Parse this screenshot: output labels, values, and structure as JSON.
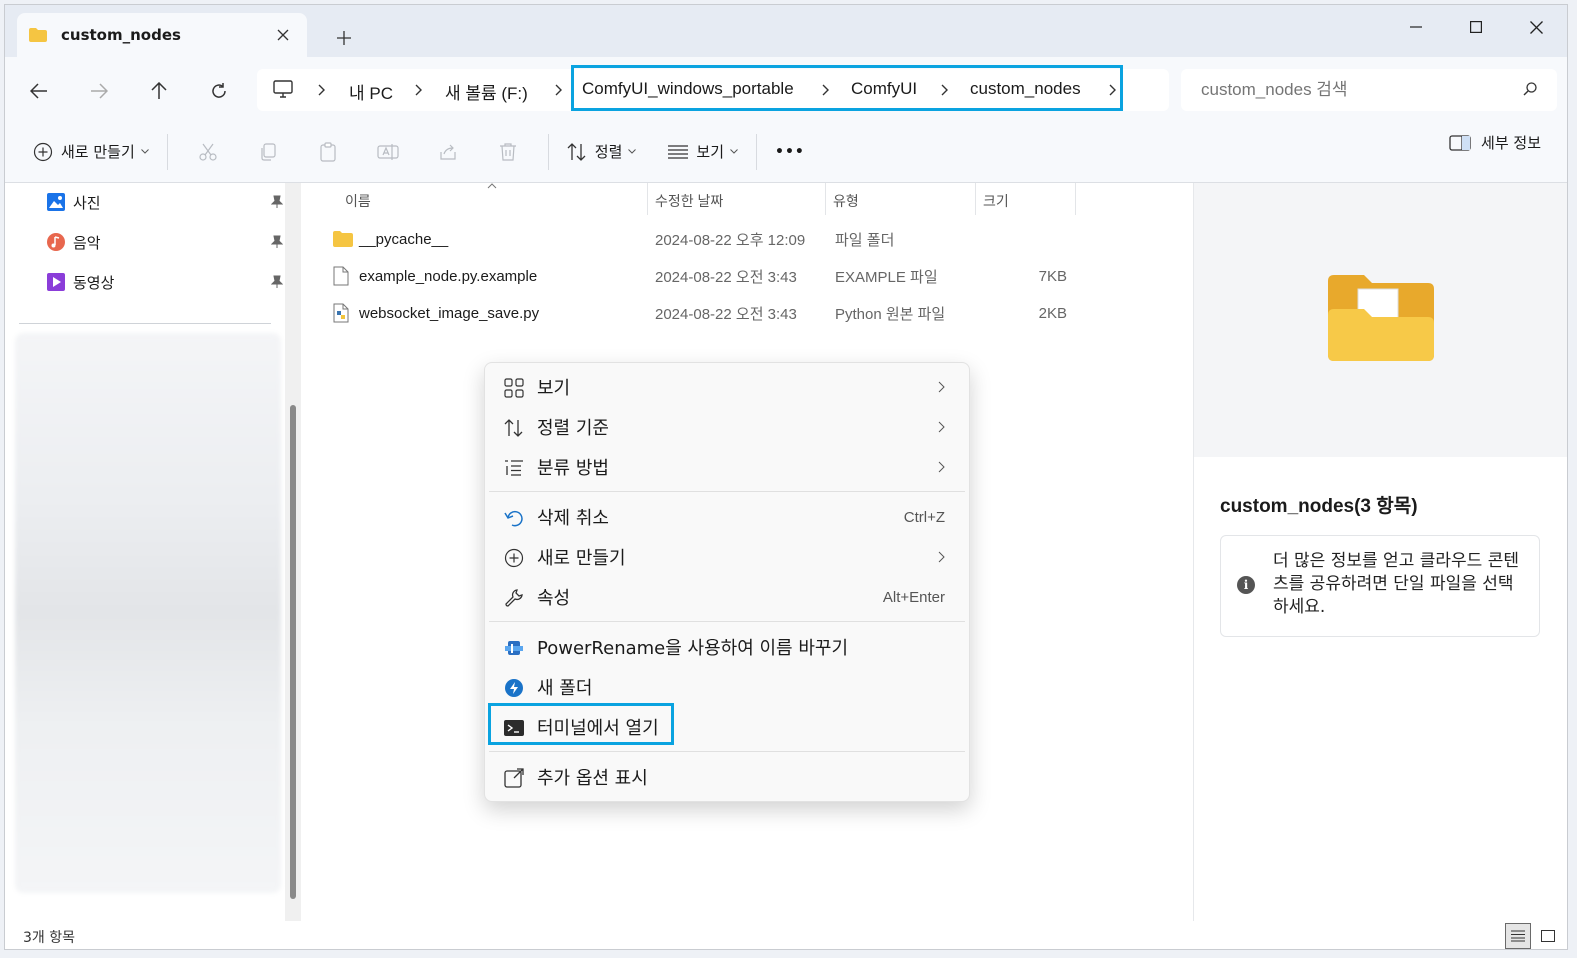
{
  "tab": {
    "title": "custom_nodes"
  },
  "address": {
    "crumbs": [
      "내 PC",
      "새 볼륨 (F:)",
      "ComfyUI_windows_portable",
      "ComfyUI",
      "custom_nodes"
    ]
  },
  "search": {
    "placeholder": "custom_nodes 검색"
  },
  "toolbar": {
    "new_label": "새로 만들기",
    "sort_label": "정렬",
    "view_label": "보기",
    "more_label": "•••",
    "details_label": "세부 정보"
  },
  "sidebar": {
    "items": [
      {
        "label": "사진"
      },
      {
        "label": "음악"
      },
      {
        "label": "동영상"
      }
    ]
  },
  "filelist": {
    "headers": [
      "이름",
      "수정한 날짜",
      "유형",
      "크기"
    ],
    "rows": [
      {
        "name": "__pycache__",
        "date": "2024-08-22 오후 12:09",
        "type": "파일 폴더",
        "size": ""
      },
      {
        "name": "example_node.py.example",
        "date": "2024-08-22 오전 3:43",
        "type": "EXAMPLE 파일",
        "size": "7KB"
      },
      {
        "name": "websocket_image_save.py",
        "date": "2024-08-22 오전 3:43",
        "type": "Python 원본 파일",
        "size": "2KB"
      }
    ]
  },
  "context_menu": {
    "items": [
      {
        "label": "보기",
        "icon": "grid-icon",
        "submenu": true
      },
      {
        "label": "정렬 기준",
        "icon": "sort-icon",
        "submenu": true
      },
      {
        "label": "분류 방법",
        "icon": "group-icon",
        "submenu": true
      },
      {
        "label": "삭제 취소",
        "icon": "undo-icon",
        "shortcut": "Ctrl+Z"
      },
      {
        "label": "새로 만들기",
        "icon": "add-circle-icon",
        "submenu": true
      },
      {
        "label": "속성",
        "icon": "wrench-icon",
        "shortcut": "Alt+Enter"
      },
      {
        "label": "PowerRename을 사용하여 이름 바꾸기",
        "icon": "powerrename-icon"
      },
      {
        "label": "새 폴더",
        "icon": "new-folder-icon"
      },
      {
        "label": "터미널에서 열기",
        "icon": "terminal-icon"
      },
      {
        "label": "추가 옵션 표시",
        "icon": "more-options-icon"
      }
    ]
  },
  "details": {
    "title": "custom_nodes(3 항목)",
    "info": "더 많은 정보를 얻고 클라우드 콘텐츠를 공유하려면 단일 파일을 선택하세요."
  },
  "status": {
    "text": "3개 항목"
  },
  "colors": {
    "highlight": "#0aa3e0",
    "folder": "#f5c542"
  }
}
